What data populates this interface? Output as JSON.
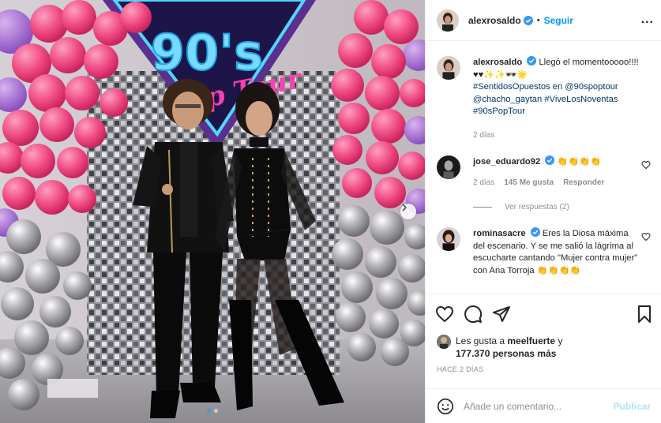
{
  "photo": {
    "banner_text": "90's",
    "banner_subtext": "Pop Tour",
    "carousel_index": 1,
    "carousel_total": 2
  },
  "header": {
    "username": "alexrosaldo",
    "separator": "•",
    "follow_label": "Seguir",
    "more_label": "..."
  },
  "caption": {
    "username": "alexrosaldo",
    "text": "Llegó el momentooooo!!!! ♥♥✨✨🕶🌟",
    "tags": "#SentidosOpuestos en @90spoptour @chacho_gaytan #ViveLosNoventas #90sPopTour",
    "time": "2 días"
  },
  "comments": [
    {
      "username": "jose_eduardo92",
      "text": "👏👏👏👏",
      "time": "2 días",
      "likes": "145 Me gusta",
      "reply_label": "Responder",
      "view_replies": "Ver respuestas (2)"
    },
    {
      "username": "rominasacre",
      "text": "Eres la Diosa máxima del escenario. Y se me salió la lágrima al escucharte cantando \"Mujer contra mujer\" con Ana Torroja 👏👏👏👏"
    }
  ],
  "likes": {
    "prefix": "Les gusta a",
    "user": "meelfuerte",
    "suffix": "y",
    "count": "177.370 personas más"
  },
  "date_label": "HACE 2 DÍAS",
  "add_comment": {
    "placeholder": "Añade un comentario...",
    "publish_label": "Publicar"
  },
  "colors": {
    "accent": "#0095f6",
    "publish_disabled": "#b2dffc",
    "muted": "#8e8e8e",
    "link": "#00376b"
  }
}
